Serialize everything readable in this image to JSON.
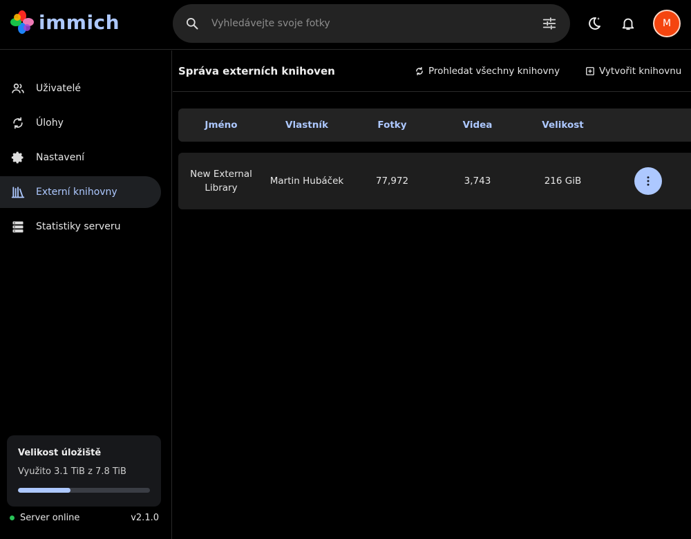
{
  "app": {
    "name": "immich"
  },
  "search": {
    "placeholder": "Vyhledávejte svoje fotky"
  },
  "user": {
    "initial": "M"
  },
  "sidebar": {
    "items": [
      {
        "label": "Uživatelé",
        "icon": "users-icon"
      },
      {
        "label": "Úlohy",
        "icon": "sync-icon"
      },
      {
        "label": "Nastavení",
        "icon": "gear-icon"
      },
      {
        "label": "Externí knihovny",
        "icon": "library-icon",
        "active": true
      },
      {
        "label": "Statistiky serveru",
        "icon": "server-icon"
      }
    ]
  },
  "storage": {
    "title": "Velikost úložiště",
    "used_text": "Využito 3.1 TiB z 7.8 TiB",
    "used_fraction": 0.4
  },
  "server": {
    "status": "Server online",
    "version": "v2.1.0"
  },
  "page": {
    "title": "Správa externích knihoven",
    "scan_all_label": "Prohledat všechny knihovny",
    "create_label": "Vytvořit knihovnu"
  },
  "table": {
    "headers": [
      "Jméno",
      "Vlastník",
      "Fotky",
      "Videa",
      "Velikost"
    ],
    "rows": [
      {
        "name": "New External Library",
        "owner": "Martin Hubáček",
        "photos": "77,972",
        "videos": "3,743",
        "size": "216 GiB"
      }
    ]
  },
  "colors": {
    "accent": "#adc8ff",
    "avatar": "#f5450f",
    "online": "#29c357"
  }
}
